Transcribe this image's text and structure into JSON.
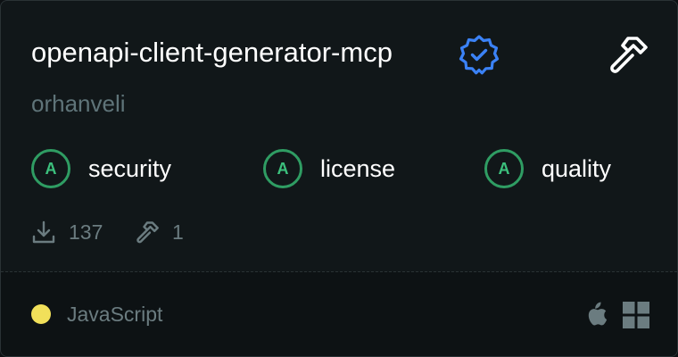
{
  "server": {
    "name": "openapi-client-generator-mcp",
    "author": "orhanveli",
    "verified": true
  },
  "grades": [
    {
      "letter": "A",
      "label": "security"
    },
    {
      "letter": "A",
      "label": "license"
    },
    {
      "letter": "A",
      "label": "quality"
    }
  ],
  "stats": {
    "downloads": "137",
    "tools": "1"
  },
  "footer": {
    "language": "JavaScript",
    "language_color": "#f1e05a",
    "platforms": [
      "apple-icon",
      "windows-icon"
    ]
  },
  "colors": {
    "accent_verified": "#3b82f6",
    "grade_green": "#2f9d63"
  }
}
